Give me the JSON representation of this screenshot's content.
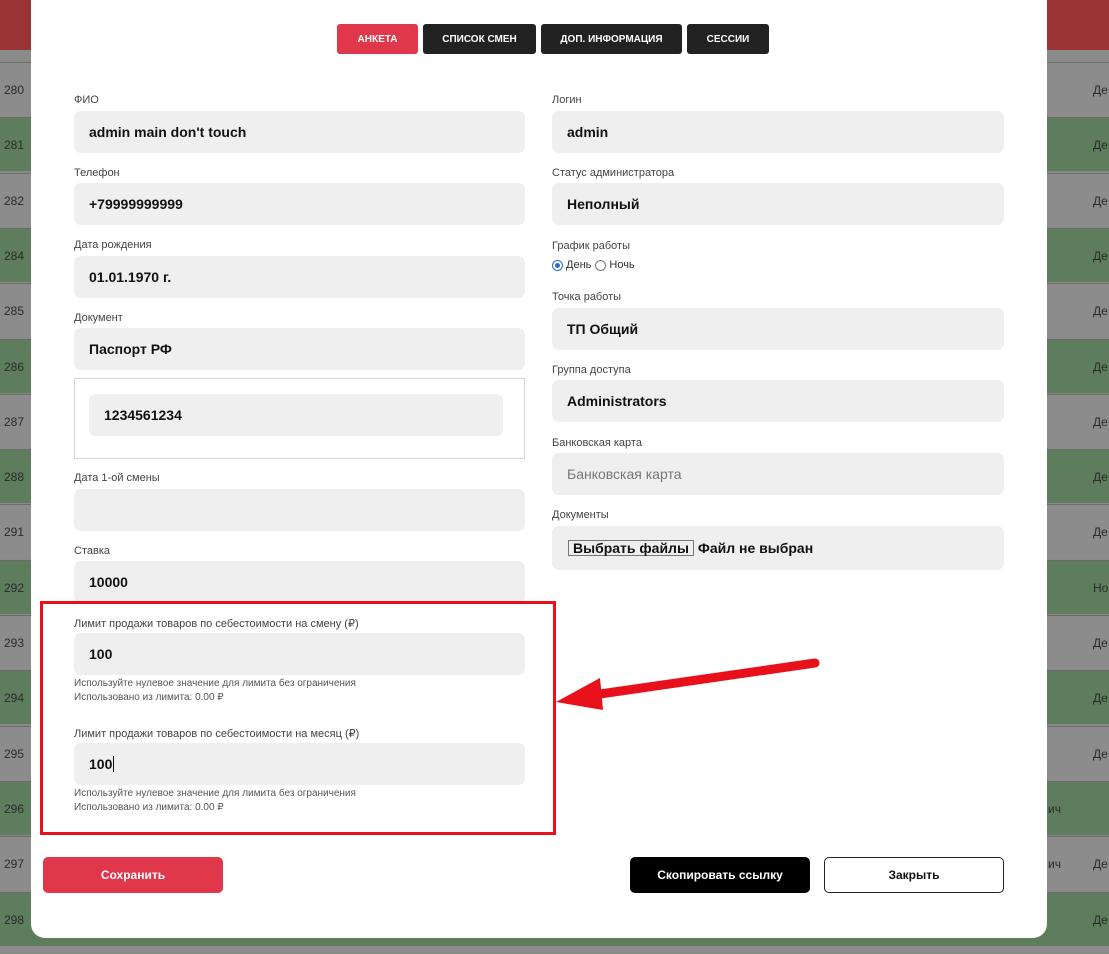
{
  "background_rows": [
    {
      "num": "280",
      "right": "Де",
      "extra": ""
    },
    {
      "num": "281",
      "right": "Де",
      "extra": ""
    },
    {
      "num": "282",
      "right": "Де",
      "extra": ""
    },
    {
      "num": "284",
      "right": "Де",
      "extra": ""
    },
    {
      "num": "285",
      "right": "Де",
      "extra": ""
    },
    {
      "num": "286",
      "right": "Де",
      "extra": ""
    },
    {
      "num": "287",
      "right": "Де",
      "extra": ""
    },
    {
      "num": "288",
      "right": "Де",
      "extra": ""
    },
    {
      "num": "291",
      "right": "Де",
      "extra": ""
    },
    {
      "num": "292",
      "right": "Но",
      "extra": ""
    },
    {
      "num": "293",
      "right": "Де",
      "extra": ""
    },
    {
      "num": "294",
      "right": "Де",
      "extra": ""
    },
    {
      "num": "295",
      "right": "Де",
      "extra": ""
    },
    {
      "num": "296",
      "right": "",
      "extra": "ич"
    },
    {
      "num": "297",
      "right": "Де",
      "extra": "ич"
    },
    {
      "num": "298",
      "right": "Де",
      "extra": ""
    }
  ],
  "tabs": [
    {
      "label": "Анкета",
      "active": true
    },
    {
      "label": "Список смен",
      "active": false
    },
    {
      "label": "Доп. информация",
      "active": false
    },
    {
      "label": "Сессии",
      "active": false
    }
  ],
  "left": {
    "fio": {
      "label": "ФИО",
      "value": "admin main don't touch"
    },
    "phone": {
      "label": "Телефон",
      "value": "+79999999999"
    },
    "birth": {
      "label": "Дата рождения",
      "value": "01.01.1970 г."
    },
    "document": {
      "label": "Документ",
      "value": "Паспорт РФ",
      "number": "1234561234"
    },
    "first_shift": {
      "label": "Дата 1-ой смены",
      "value": ""
    },
    "rate": {
      "label": "Ставка",
      "value": "10000"
    },
    "limit_shift": {
      "label": "Лимит продажи товаров по себестоимости на смену (₽)",
      "value": "100",
      "hint": "Используйте нулевое значение для лимита без ограничения",
      "used": "Использовано из лимита: 0.00 ₽"
    },
    "limit_month": {
      "label": "Лимит продажи товаров по себестоимости на месяц (₽)",
      "value": "100",
      "hint": "Используйте нулевое значение для лимита без ограничения",
      "used": "Использовано из лимита: 0.00 ₽"
    }
  },
  "right": {
    "login": {
      "label": "Логин",
      "value": "admin"
    },
    "status": {
      "label": "Статус администратора",
      "value": "Неполный"
    },
    "schedule": {
      "label": "График работы",
      "option_day": "День",
      "option_night": "Ночь",
      "selected": "День"
    },
    "point": {
      "label": "Точка работы",
      "value": "ТП Общий"
    },
    "group": {
      "label": "Группа доступа",
      "value": "Administrators"
    },
    "card": {
      "label": "Банковская карта",
      "placeholder": "Банковская карта"
    },
    "documents": {
      "label": "Документы",
      "button": "Выбрать файлы",
      "status": "Файл не выбран"
    }
  },
  "buttons": {
    "save": "Сохранить",
    "copy_link": "Скопировать ссылку",
    "close": "Закрыть"
  },
  "colors": {
    "accent": "#e0374a",
    "annotation": "#e8101a",
    "row_green": "#5d7d5d",
    "row_gray": "#8c8c8c"
  }
}
